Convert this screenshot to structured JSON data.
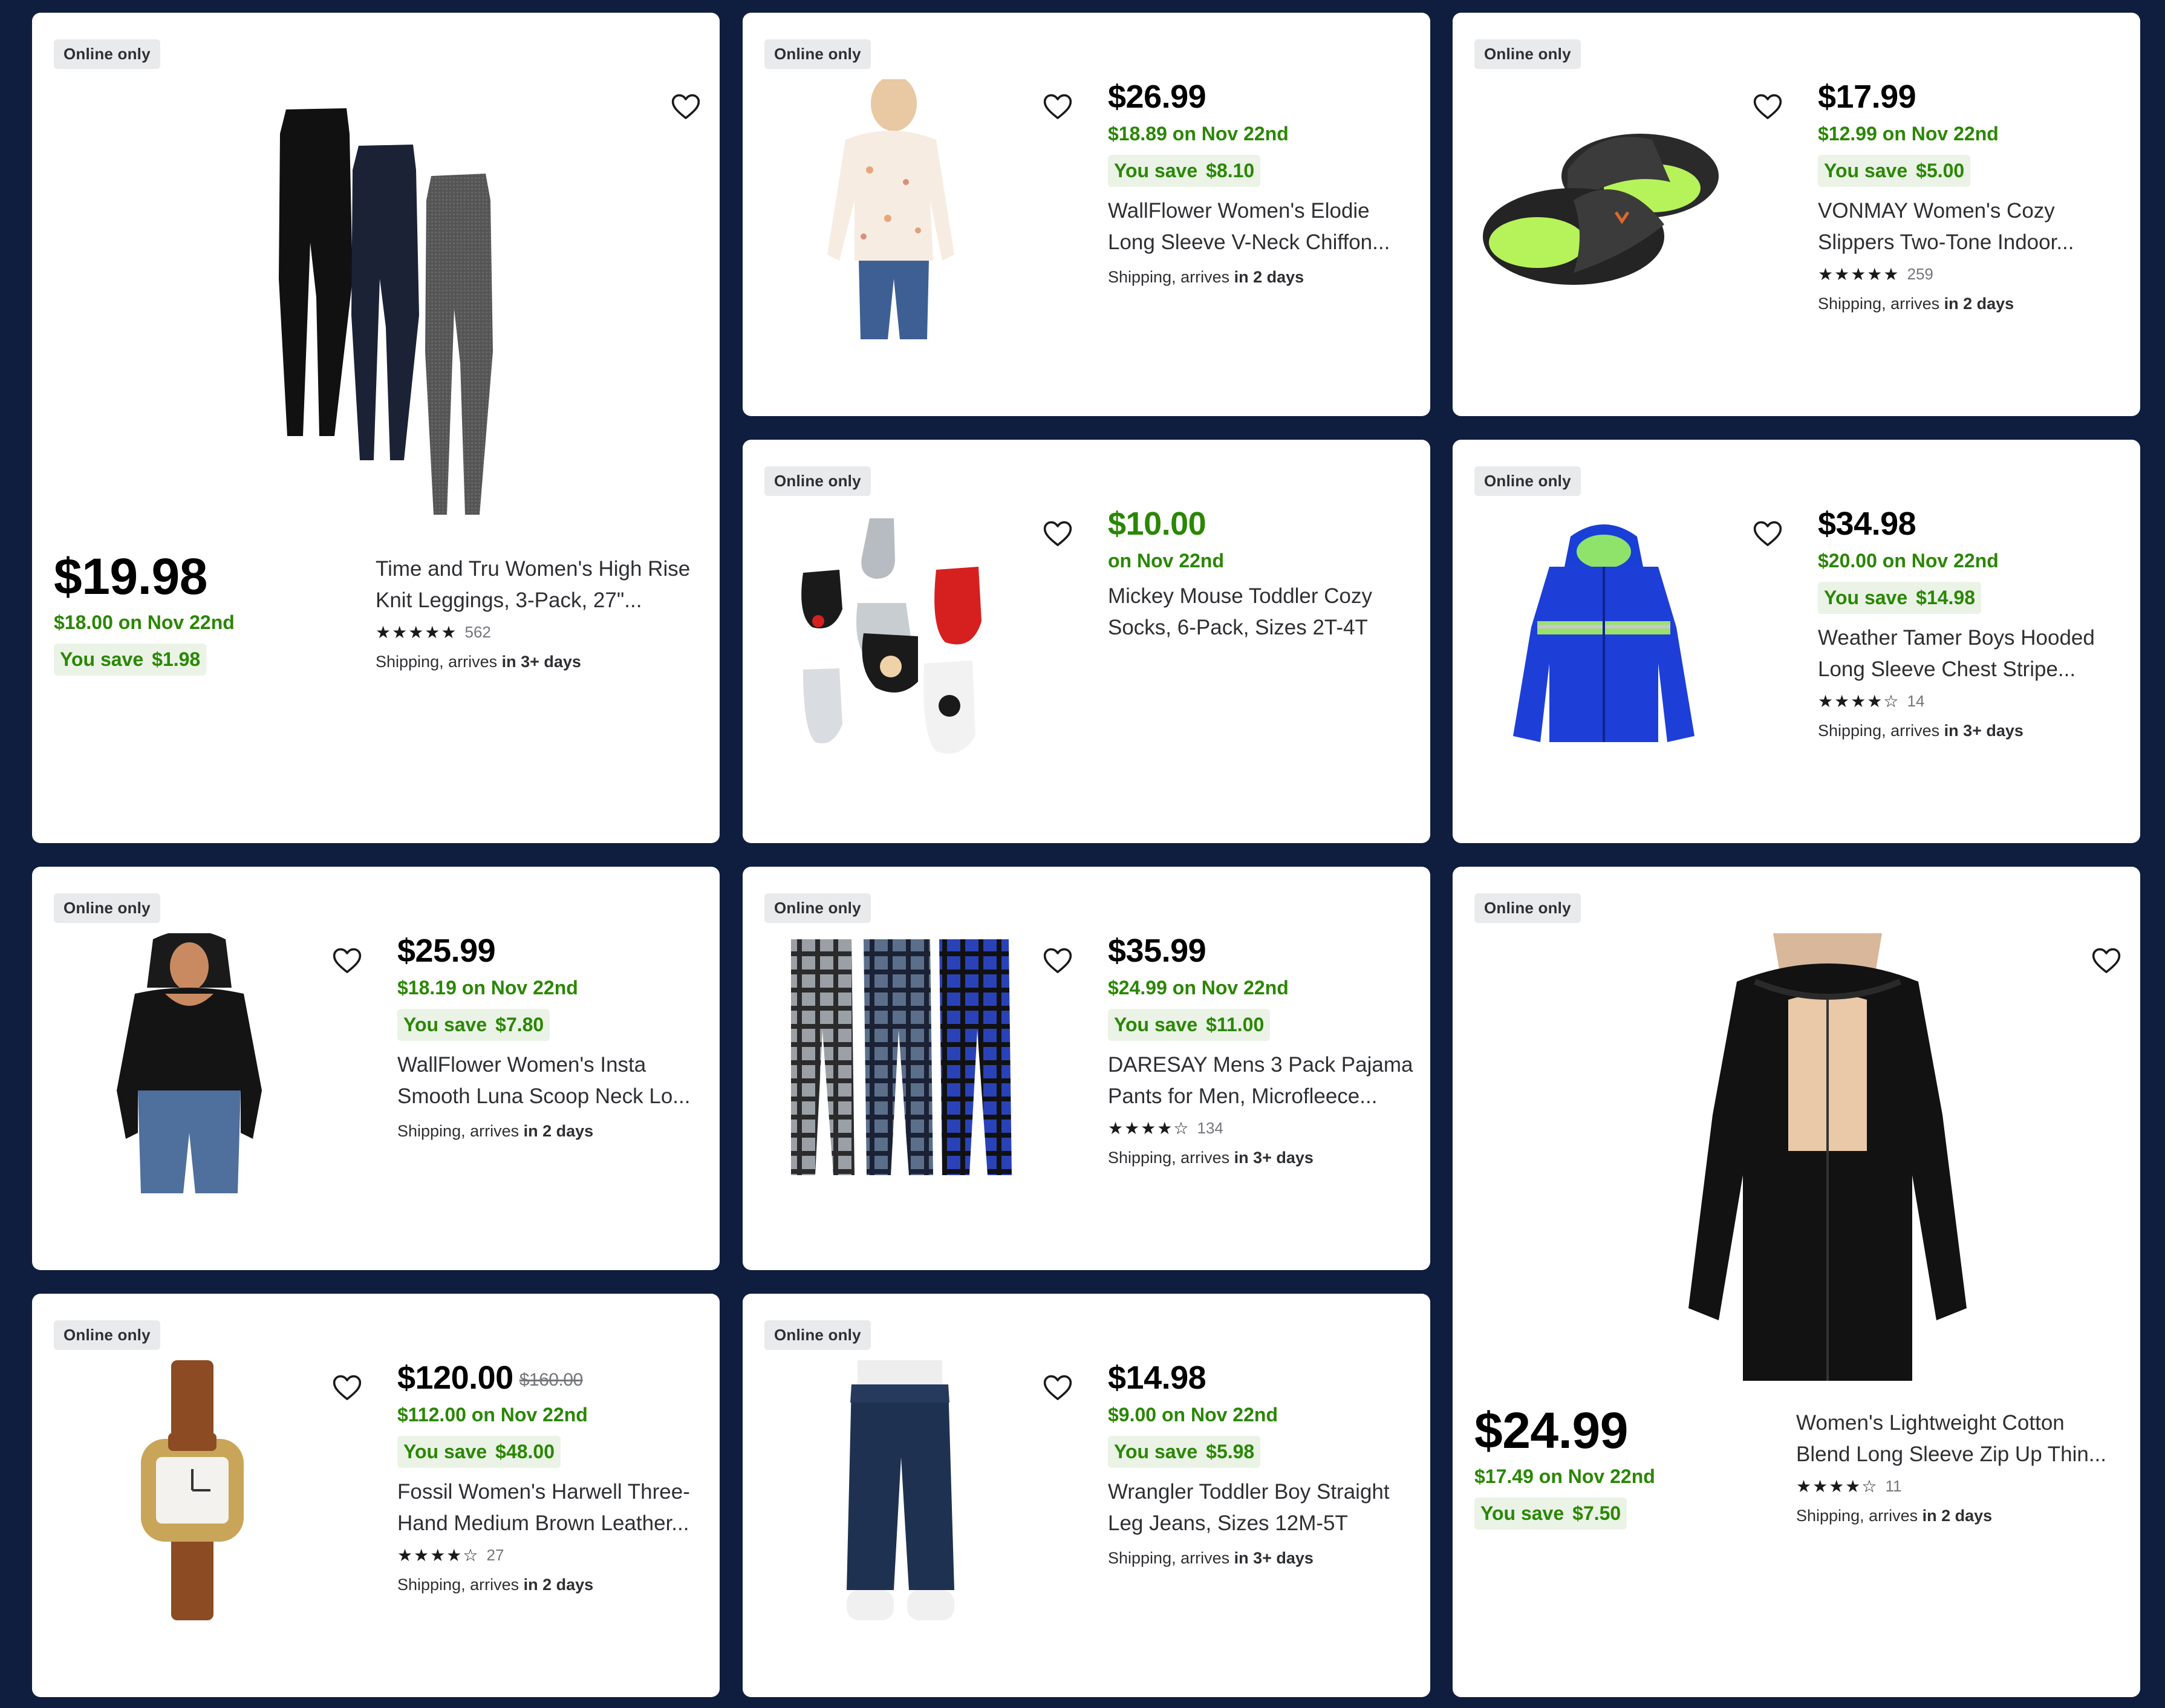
{
  "common": {
    "badge": "Online only",
    "you_save": "You save",
    "shipping_prefix": "Shipping, arrives"
  },
  "colors": {
    "background": "#0f1e3f",
    "card": "#ffffff",
    "sale_green": "#2a8703",
    "save_bg": "#eaf3e6",
    "badge_bg": "#e9eaec"
  },
  "products": [
    {
      "image": "leggings-3pack",
      "price": "$19.98",
      "sale": "$18.00 on Nov 22nd",
      "save": "$1.98",
      "title_1": "Time and Tru Women's High Rise",
      "title_2": "Knit Leggings, 3-Pack, 27\"...",
      "stars": "★★★★★",
      "reviews": "562",
      "arrives": "in 3+ days"
    },
    {
      "image": "floral-chiffon-blouse",
      "price": "$26.99",
      "sale": "$18.89 on Nov 22nd",
      "save": "$8.10",
      "title_1": "WallFlower Women's Elodie",
      "title_2": "Long Sleeve V-Neck Chiffon...",
      "arrives": "in 2 days"
    },
    {
      "image": "two-tone-slippers",
      "price": "$17.99",
      "sale": "$12.99 on Nov 22nd",
      "save": "$5.00",
      "title_1": "VONMAY Women's Cozy",
      "title_2": "Slippers Two-Tone Indoor...",
      "stars": "★★★★★",
      "reviews": "259",
      "arrives": "in 2 days"
    },
    {
      "image": "mickey-toddler-socks",
      "price": "$10.00",
      "sale": "on Nov 22nd",
      "title_1": "Mickey Mouse Toddler Cozy",
      "title_2": "Socks, 6-Pack, Sizes 2T-4T"
    },
    {
      "image": "blue-hooded-puffer-jacket",
      "price": "$34.98",
      "sale": "$20.00 on Nov 22nd",
      "save": "$14.98",
      "title_1": "Weather Tamer Boys Hooded",
      "title_2": "Long Sleeve Chest Stripe...",
      "stars": "★★★★☆",
      "reviews": "14",
      "arrives": "in 3+ days"
    },
    {
      "image": "black-scoop-neck-top",
      "price": "$25.99",
      "sale": "$18.19 on Nov 22nd",
      "save": "$7.80",
      "title_1": "WallFlower Women's Insta",
      "title_2": "Smooth Luna Scoop Neck Lo...",
      "arrives": "in 2 days"
    },
    {
      "image": "plaid-pajama-pants",
      "price": "$35.99",
      "sale": "$24.99 on Nov 22nd",
      "save": "$11.00",
      "title_1": "DARESAY Mens 3 Pack Pajama",
      "title_2": "Pants for Men, Microfleece...",
      "stars": "★★★★☆",
      "reviews": "134",
      "arrives": "in 3+ days"
    },
    {
      "image": "black-zip-hoodie",
      "price": "$24.99",
      "sale": "$17.49 on Nov 22nd",
      "save": "$7.50",
      "title_1": "Women's Lightweight Cotton",
      "title_2": "Blend Long Sleeve Zip Up Thin...",
      "stars": "★★★★☆",
      "reviews": "11",
      "arrives": "in 2 days"
    },
    {
      "image": "brown-leather-watch",
      "price": "$120.00",
      "was": "$160.00",
      "sale": "$112.00 on Nov 22nd",
      "save": "$48.00",
      "title_1": "Fossil Women's Harwell Three-",
      "title_2": "Hand Medium Brown Leather...",
      "stars": "★★★★☆",
      "reviews": "27",
      "arrives": "in 2 days"
    },
    {
      "image": "toddler-straight-jeans",
      "price": "$14.98",
      "sale": "$9.00 on Nov 22nd",
      "save": "$5.98",
      "title_1": "Wrangler Toddler Boy Straight",
      "title_2": "Leg Jeans, Sizes 12M-5T",
      "arrives": "in 3+ days"
    }
  ]
}
